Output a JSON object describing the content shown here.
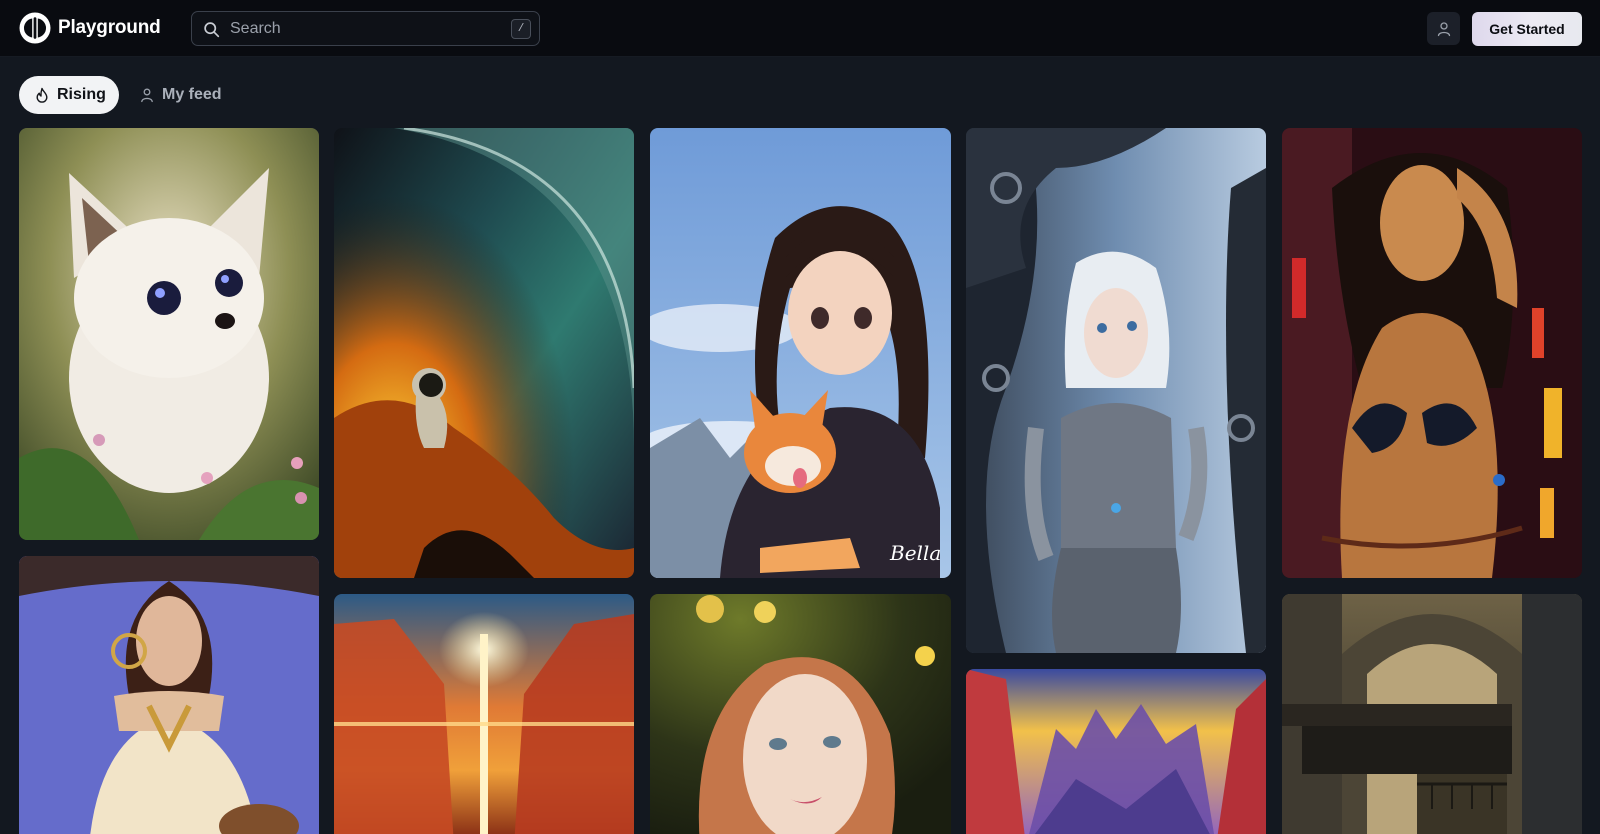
{
  "app": {
    "name": "Playground"
  },
  "header": {
    "search_placeholder": "Search",
    "search_shortcut": "/",
    "cta_label": "Get Started"
  },
  "tabs": [
    {
      "label": "Rising",
      "icon": "flame-icon",
      "active": true
    },
    {
      "label": "My feed",
      "icon": "person-icon",
      "active": false
    }
  ],
  "gallery": {
    "columns": 5,
    "images": [
      {
        "subject": "white fox kit in grass with flowers",
        "column": 1
      },
      {
        "subject": "astronaut on fiery rocks near planet",
        "column": 2
      },
      {
        "subject": "anime girl hugging shiba inu",
        "column": 3
      },
      {
        "subject": "silver armored woman with ornate frame",
        "column": 4
      },
      {
        "subject": "painted woman in bikini",
        "column": 5
      },
      {
        "subject": "woman in white gown with golden jewelry",
        "column": 1
      },
      {
        "subject": "sunset light beam between red cliffs",
        "column": 2
      },
      {
        "subject": "portrait of auburn haired woman",
        "column": 3
      },
      {
        "subject": "red mountain landscape at dawn",
        "column": 4
      },
      {
        "subject": "stone archway in old city",
        "column": 5
      }
    ],
    "signature_text": "Bella"
  },
  "colors": {
    "header_bg": "#090b10",
    "page_bg": "#131820",
    "accent": "#eceaf3"
  }
}
